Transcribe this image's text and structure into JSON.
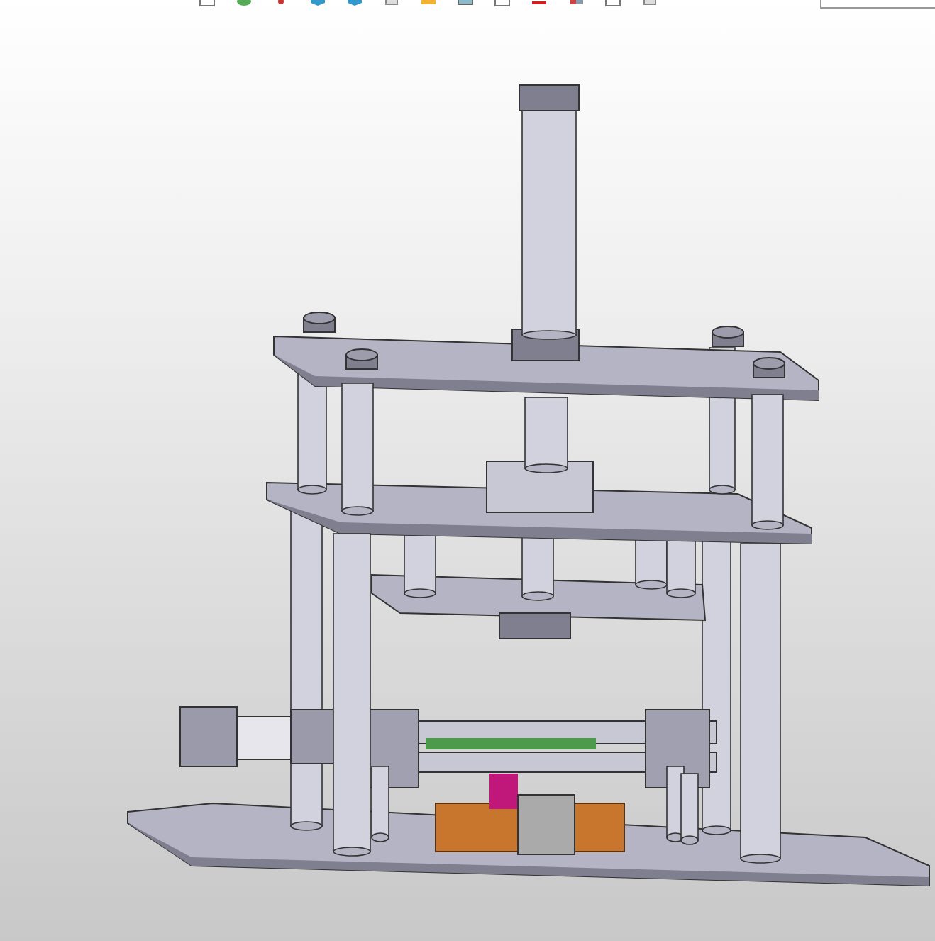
{
  "toolbar": {
    "icons": [
      {
        "kind": "doc"
      },
      {
        "kind": "layers"
      },
      {
        "kind": "dot"
      },
      {
        "kind": "cube"
      },
      {
        "kind": "cube"
      },
      {
        "kind": "box"
      },
      {
        "kind": "folder"
      },
      {
        "kind": "picture"
      },
      {
        "kind": "doc"
      },
      {
        "kind": "line"
      },
      {
        "kind": "cylinder"
      },
      {
        "kind": "doc"
      },
      {
        "kind": "box"
      }
    ]
  },
  "viewport": {
    "kind": "model"
  }
}
